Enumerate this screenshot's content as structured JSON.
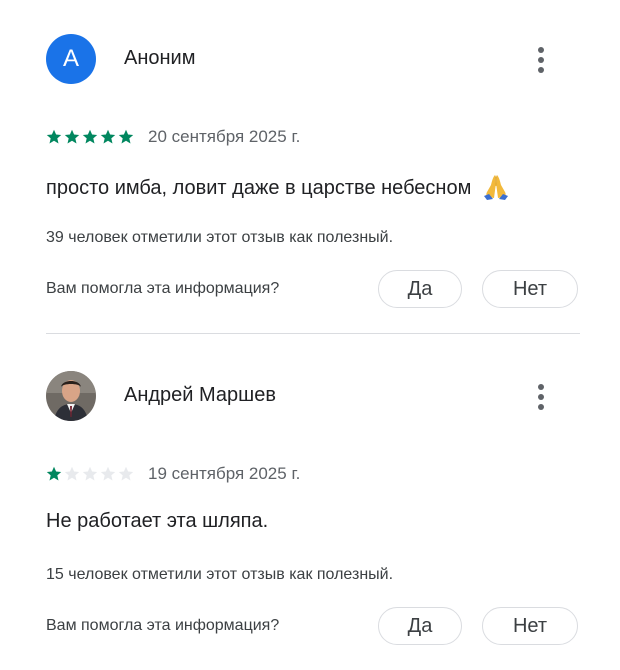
{
  "reviews": [
    {
      "avatar_letter": "А",
      "avatar_color": "#1a73e8",
      "author": "Аноним",
      "rating": 5,
      "max_rating": 5,
      "date": "20 сентября 2025 г.",
      "text": "просто имба, ловит даже в царстве небесном",
      "emoji": "folded-hands-icon",
      "helpful_count_text": "39 человек отметили этот отзыв как полезный.",
      "question": "Вам помогла эта информация?",
      "yes_label": "Да",
      "no_label": "Нет"
    },
    {
      "avatar_type": "photo",
      "author": "Андрей Маршев",
      "rating": 1,
      "max_rating": 5,
      "date": "19 сентября 2025 г.",
      "text": "Не работает эта шляпа.",
      "helpful_count_text": "15 человек отметили этот отзыв как полезный.",
      "question": "Вам помогла эта информация?",
      "yes_label": "Да",
      "no_label": "Нет"
    }
  ],
  "colors": {
    "star_filled": "#01875f",
    "star_empty": "#e8eaed",
    "accent": "#1a73e8"
  }
}
